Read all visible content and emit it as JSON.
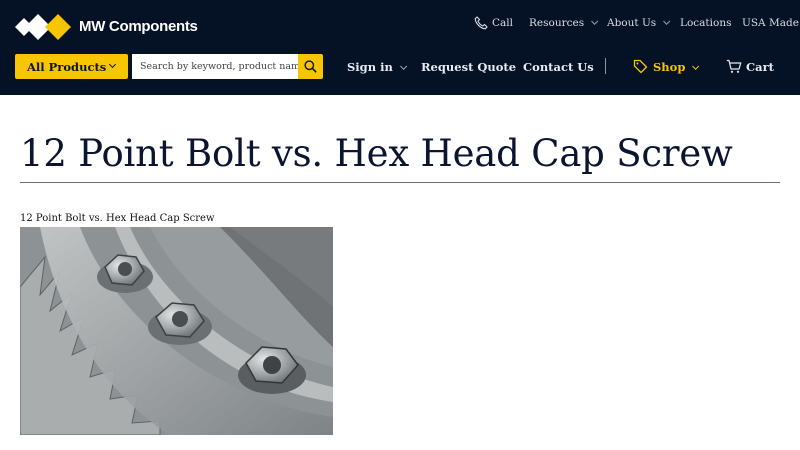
{
  "header": {
    "brand": "MW Components",
    "top_nav": {
      "call": "Call",
      "resources": "Resources",
      "about": "About Us",
      "locations": "Locations",
      "usa_made": "USA Made"
    },
    "all_products": "All Products",
    "search_placeholder": "Search by keyword, product name, category",
    "main_nav": {
      "sign_in": "Sign in",
      "request_quote": "Request Quote",
      "contact_us": "Contact Us",
      "shop": "Shop",
      "cart": "Cart"
    }
  },
  "main": {
    "title": "12 Point Bolt vs. Hex Head Cap Screw",
    "image_caption": "12 Point Bolt vs. Hex Head Cap Screw"
  },
  "colors": {
    "header_bg": "#051226",
    "accent": "#f7c600",
    "title_text": "#0b1530"
  },
  "icons": [
    "logo-mark",
    "phone-icon",
    "search-icon",
    "tag-icon",
    "cart-icon"
  ]
}
